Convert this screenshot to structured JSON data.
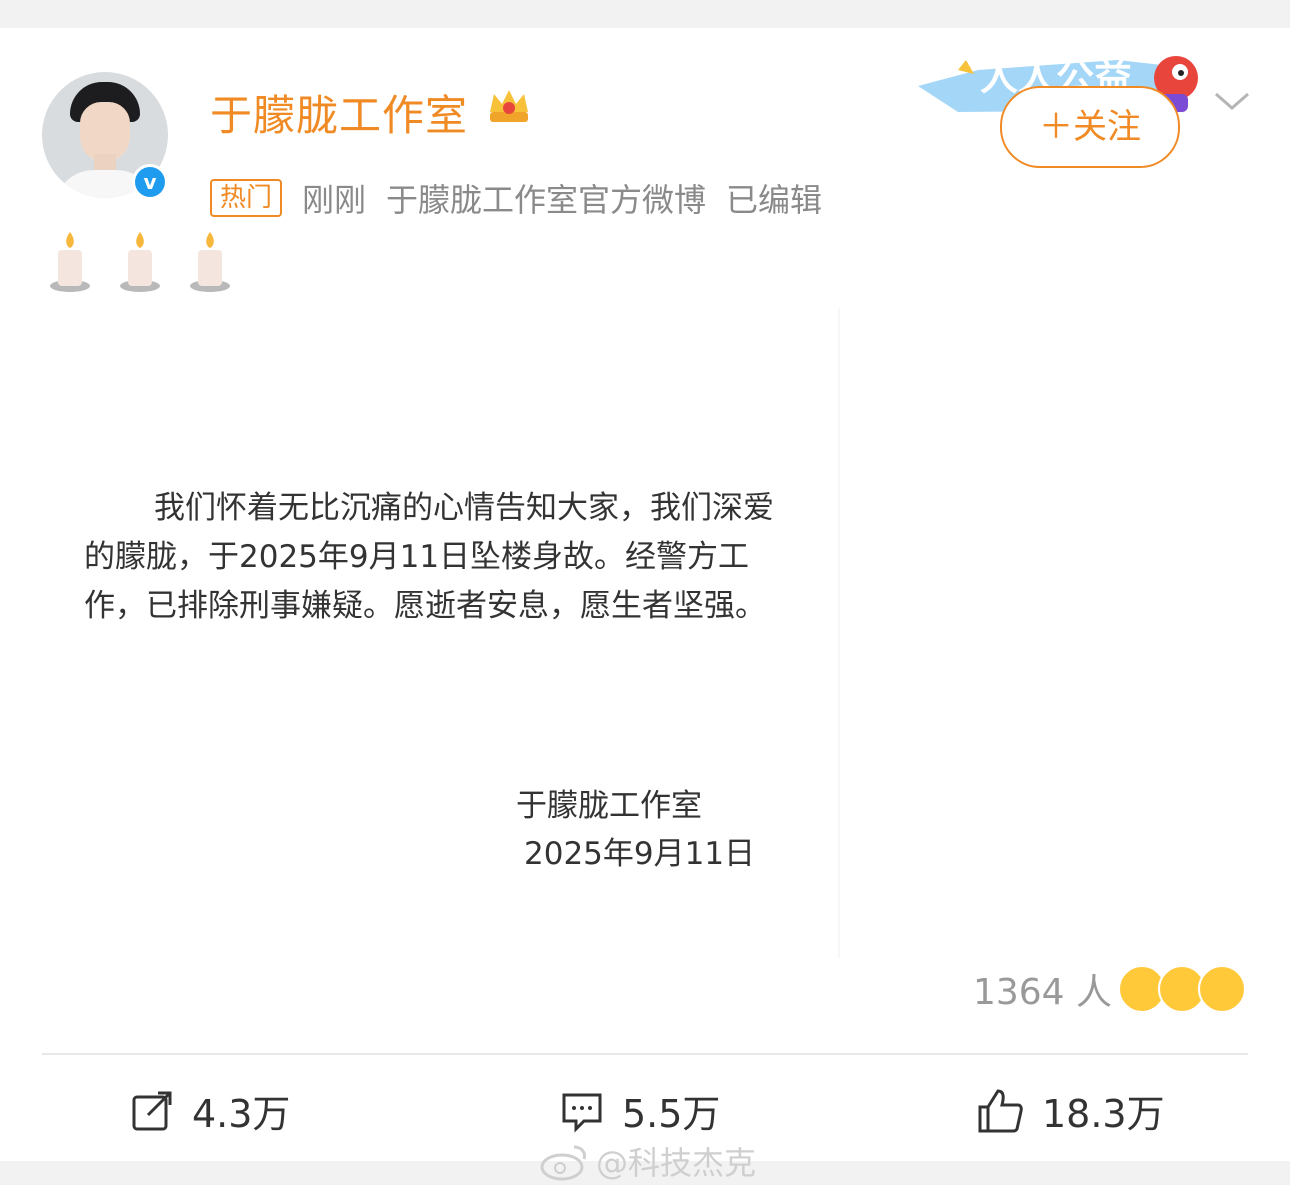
{
  "post": {
    "author_name": "于朦胧工作室",
    "hot_tag": "热门",
    "time": "刚刚",
    "source": "于朦胧工作室官方微博",
    "edited": "已编辑",
    "banner_text": "人人公益",
    "follow_label": "＋关注",
    "statement": "我们怀着无比沉痛的心情告知大家，我们深爱的朦胧，于2025年9月11日坠楼身故。经警方工作，已排除刑事嫌疑。愿逝者安息，愿生者坚强。",
    "signature_name": "于朦胧工作室",
    "signature_date": "2025年9月11日"
  },
  "reactions": {
    "count": "1364 人"
  },
  "actions": {
    "repost": "4.3万",
    "comment": "5.5万",
    "like": "18.3万"
  },
  "watermark": "@科技杰克",
  "colors": {
    "accent": "#f08a24",
    "verified": "#1f9cf0",
    "muted": "#8a8a8a"
  }
}
